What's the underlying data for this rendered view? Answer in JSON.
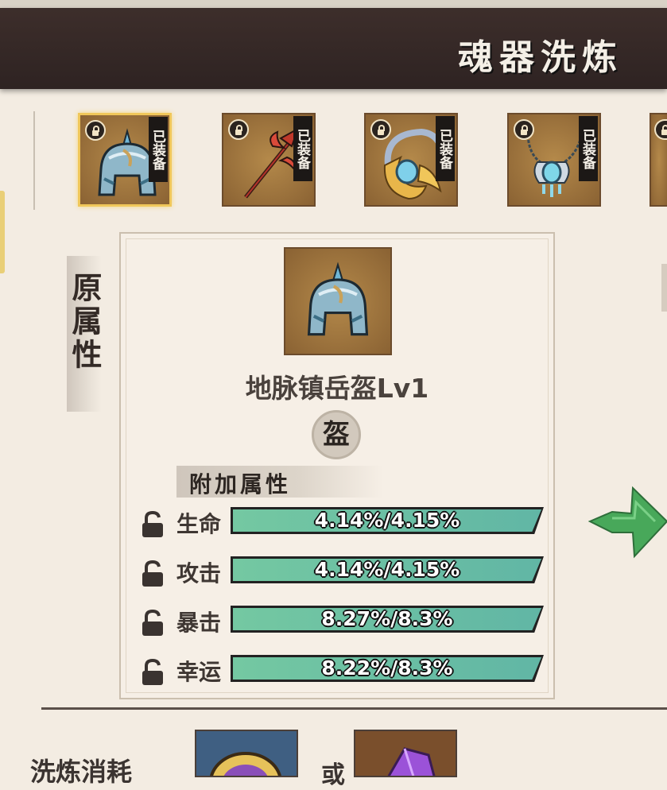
{
  "header": {
    "title": "魂器洗炼"
  },
  "equip_slots": [
    {
      "name": "helmet",
      "tag": "已装备",
      "locked": true,
      "selected": true
    },
    {
      "name": "halberd",
      "tag": "已装备",
      "locked": true,
      "selected": false
    },
    {
      "name": "golden-armor",
      "tag": "已装备",
      "locked": true,
      "selected": false
    },
    {
      "name": "jade-necklace",
      "tag": "已装备",
      "locked": true,
      "selected": false
    }
  ],
  "side_label": "原属性",
  "item": {
    "name": "地脉镇岳盔Lv1",
    "type_badge": "盔"
  },
  "attributes": {
    "title": "附加属性",
    "rows": [
      {
        "name": "生命",
        "value": "4.14%/4.15%"
      },
      {
        "name": "攻击",
        "value": "4.14%/4.15%"
      },
      {
        "name": "暴击",
        "value": "8.27%/8.3%"
      },
      {
        "name": "幸运",
        "value": "8.22%/8.3%"
      }
    ]
  },
  "bottom": {
    "label": "洗炼消耗",
    "or_text": "或"
  },
  "colors": {
    "header_bg": "#2e2322",
    "bar_fill": "#6cc0a3",
    "arrow": "#3e9e50",
    "selected_border": "#f0c75a"
  }
}
